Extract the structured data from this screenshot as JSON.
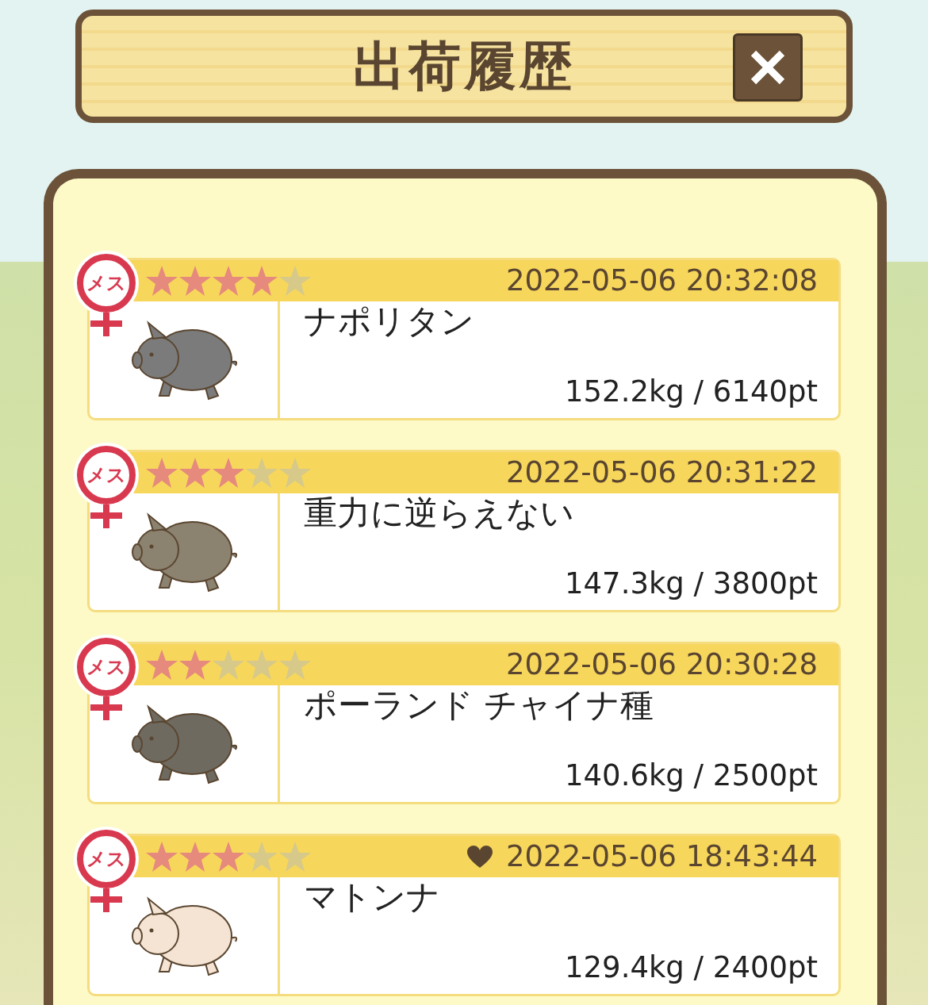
{
  "title": "出荷履歴",
  "records": [
    {
      "gender": "メス",
      "stars": 4,
      "favorite": false,
      "date": "2022-05-06 20:32:08",
      "name": "ナポリタン",
      "weight_points": "152.2kg / 6140pt",
      "color": "#7b7b7b"
    },
    {
      "gender": "メス",
      "stars": 3,
      "favorite": false,
      "date": "2022-05-06 20:31:22",
      "name": "重力に逆らえない",
      "weight_points": "147.3kg / 3800pt",
      "color": "#8c8270"
    },
    {
      "gender": "メス",
      "stars": 2,
      "favorite": false,
      "date": "2022-05-06 20:30:28",
      "name": "ポーランド チャイナ種",
      "weight_points": "140.6kg / 2500pt",
      "color": "#6e6a60"
    },
    {
      "gender": "メス",
      "stars": 3,
      "favorite": true,
      "date": "2022-05-06 18:43:44",
      "name": "マトンナ",
      "weight_points": "129.4kg / 2400pt",
      "color": "#f5e4d4"
    }
  ]
}
